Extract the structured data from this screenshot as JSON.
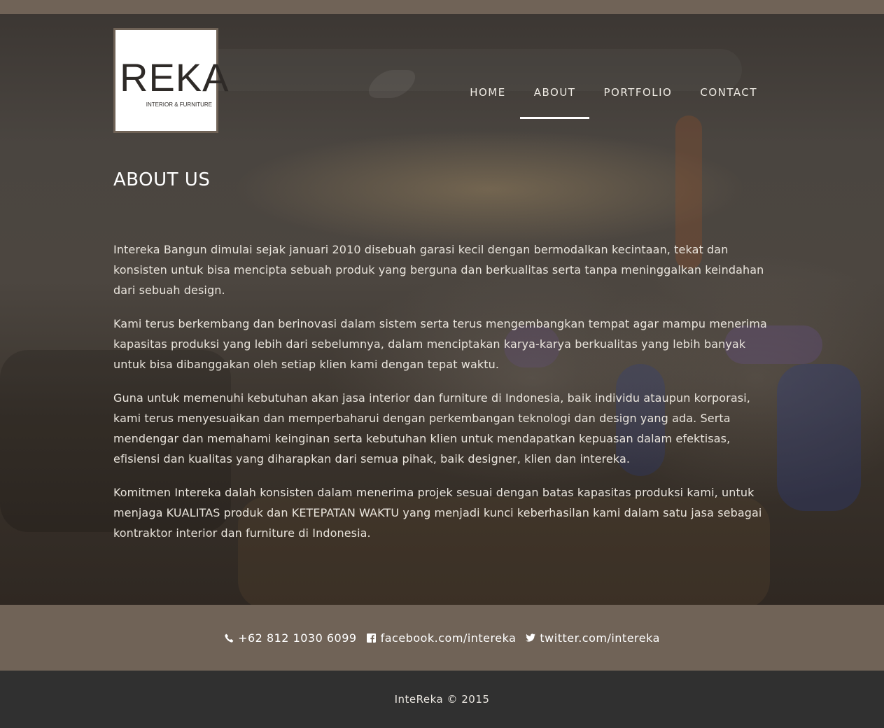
{
  "logo": {
    "main": "REKA",
    "sub": "INTERIOR & FURNITURE"
  },
  "nav": {
    "items": [
      {
        "label": "HOME"
      },
      {
        "label": "ABOUT"
      },
      {
        "label": "PORTFOLIO"
      },
      {
        "label": "CONTACT"
      }
    ],
    "active": "ABOUT"
  },
  "about": {
    "title": "ABOUT US",
    "paragraphs": [
      "Intereka Bangun dimulai sejak januari 2010 disebuah garasi kecil dengan bermodalkan kecintaan, tekat dan konsisten untuk bisa mencipta sebuah produk yang berguna dan berkualitas serta tanpa meninggalkan keindahan dari sebuah design.",
      "Kami terus berkembang dan berinovasi dalam sistem serta terus mengembangkan tempat agar mampu menerima kapasitas produksi yang lebih dari sebelumnya, dalam menciptakan karya-karya berkualitas yang lebih banyak untuk bisa dibanggakan oleh setiap klien kami dengan tepat waktu.",
      "Guna untuk memenuhi kebutuhan akan jasa interior dan furniture di Indonesia, baik individu ataupun korporasi, kami terus menyesuaikan dan memperbaharui dengan perkembangan teknologi dan design yang ada. Serta mendengar dan memahami keinginan serta kebutuhan klien untuk mendapatkan kepuasan dalam efektisas, efisiensi dan kualitas yang diharapkan dari semua pihak, baik designer, klien dan intereka.",
      "Komitmen Intereka dalah konsisten dalam menerima projek sesuai dengan batas kapasitas produksi kami, untuk menjaga KUALITAS produk dan KETEPATAN WAKTU yang menjadi kunci keberhasilan kami dalam satu jasa sebagai kontraktor interior dan furniture di Indonesia."
    ]
  },
  "contact": {
    "phone": "+62 812 1030 6099",
    "facebook": "facebook.com/intereka",
    "twitter": "twitter.com/intereka",
    "icons": {
      "phone": "phone-icon",
      "facebook": "facebook-icon",
      "twitter": "twitter-icon"
    }
  },
  "footer": {
    "copyright": "InteReka © 2015"
  },
  "colors": {
    "brand": "#706357",
    "footer": "#303030"
  }
}
